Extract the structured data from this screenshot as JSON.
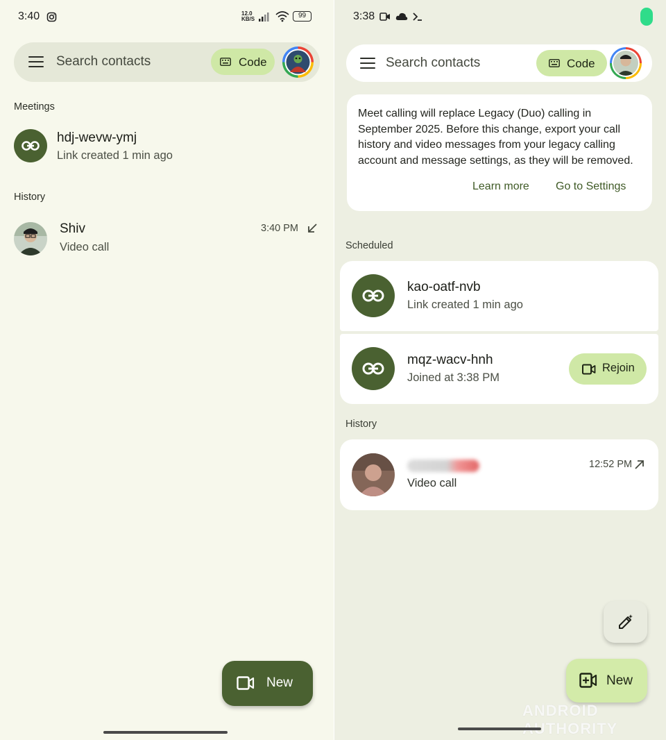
{
  "left": {
    "status": {
      "time": "3:40",
      "speed": "12.0\nKB/S",
      "battery": "99"
    },
    "search": {
      "placeholder": "Search contacts",
      "code_label": "Code"
    },
    "meetings_heading": "Meetings",
    "meeting": {
      "title": "hdj-wevw-ymj",
      "subtitle": "Link created 1 min ago"
    },
    "history_heading": "History",
    "history": [
      {
        "name": "Shiv",
        "type": "Video call",
        "time": "3:40 PM",
        "direction": "incoming"
      }
    ],
    "fab": {
      "label": "New",
      "icon": "videocam-icon"
    }
  },
  "right": {
    "status": {
      "time": "3:38"
    },
    "search": {
      "placeholder": "Search contacts",
      "code_label": "Code"
    },
    "notice": {
      "text": "Meet calling will replace Legacy (Duo) calling in September 2025. Before this change, export your call history and video messages from your legacy calling account and message settings, as they will be removed.",
      "learn_more": "Learn more",
      "settings": "Go to Settings"
    },
    "scheduled_heading": "Scheduled",
    "scheduled": [
      {
        "title": "kao-oatf-nvb",
        "subtitle": "Link created 1 min ago"
      },
      {
        "title": "mqz-wacv-hnh",
        "subtitle": "Joined at 3:38 PM",
        "action": "Rejoin"
      }
    ],
    "history_heading": "History",
    "history": [
      {
        "type": "Video call",
        "time": "12:52 PM",
        "direction": "outgoing"
      }
    ],
    "fab": {
      "label": "New",
      "icon": "add-video-icon"
    },
    "watermark": "ANDROID AUTHORITY"
  },
  "colors": {
    "accent_dark": "#4a6131",
    "chip": "#cfe8a6",
    "fab_dark": "#4a6131",
    "fab_light": "#d3eba9"
  }
}
